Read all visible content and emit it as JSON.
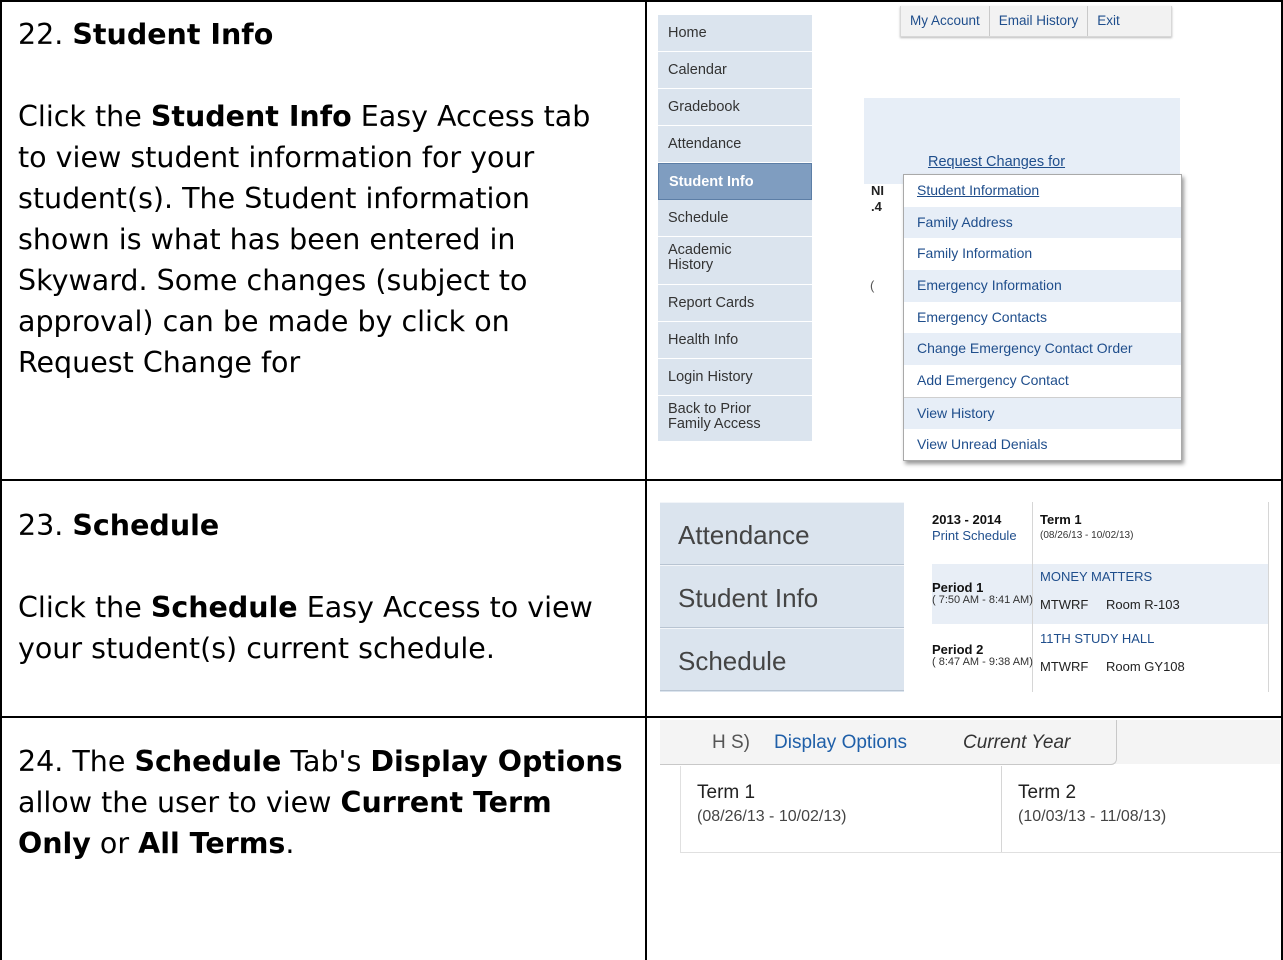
{
  "rows": [
    {
      "number": "22.",
      "title": "Student Info",
      "text_parts": [
        "Click the ",
        "Student Info",
        " Easy Access tab to view student information for your student(s). The Student information shown is what has been entered in Skyward.  Some changes (subject to approval) can be made by click on Request Change for"
      ]
    },
    {
      "number": "23.",
      "title": "Schedule",
      "text_parts": [
        "Click the ",
        "Schedule",
        " Easy Access to view your student(s) current schedule."
      ]
    },
    {
      "number": "24.",
      "title_parts": [
        "The ",
        "Schedule",
        " Tab's ",
        "Display Options"
      ],
      "text_parts": [
        "allow the user to view ",
        "Current Term Only",
        " or ",
        "All Terms",
        "."
      ]
    }
  ],
  "shot1": {
    "nav": [
      "Home",
      "Calendar",
      "Gradebook",
      "Attendance",
      "Student Info",
      "Schedule",
      "Academic History",
      "Report Cards",
      "Health Info",
      "Login History",
      "Back to Prior Family Access"
    ],
    "nav_multiline": {
      "academic_1": "Academic",
      "academic_2": "History",
      "back_1": "Back to Prior",
      "back_2": "Family Access"
    },
    "active": "Student Info",
    "account_links": [
      "My Account",
      "Email History",
      "Exit"
    ],
    "request_link": "Request Changes for",
    "ghost_text": [
      "NI",
      ".4",
      "("
    ],
    "dropdown": [
      "Student Information",
      "Family Address",
      "Family Information",
      "Emergency Information",
      "Emergency Contacts",
      "Change Emergency Contact Order",
      "Add Emergency Contact",
      "View History",
      "View Unread Denials"
    ]
  },
  "shot2": {
    "nav": [
      "Attendance",
      "Student Info",
      "Schedule"
    ],
    "year": "2013 - 2014",
    "print": "Print Schedule",
    "term": "Term 1",
    "term_range": "(08/26/13 - 10/02/13)",
    "periods": [
      {
        "name": "Period 1",
        "time": "( 7:50 AM - 8:41 AM)",
        "course": "MONEY MATTERS",
        "days": "MTWRF",
        "room": "Room R-103"
      },
      {
        "name": "Period 2",
        "time": "( 8:47 AM - 9:38 AM)",
        "course": "11TH STUDY HALL",
        "days": "MTWRF",
        "room": "Room GY108"
      }
    ]
  },
  "shot3": {
    "hs": "H S)",
    "display_options": "Display Options",
    "current_year": "Current Year",
    "terms": [
      {
        "title": "Term 1",
        "range": "(08/26/13 - 10/02/13)"
      },
      {
        "title": "Term 2",
        "range": "(10/03/13 - 11/08/13)"
      }
    ]
  }
}
